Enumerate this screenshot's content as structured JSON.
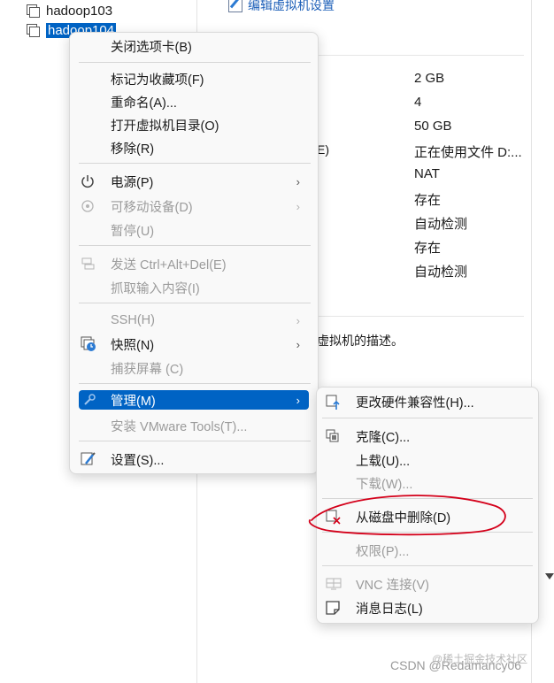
{
  "tree": {
    "items": [
      {
        "label": "hadoop103",
        "selected": false
      },
      {
        "label": "hadoop104",
        "selected": true
      }
    ]
  },
  "details": {
    "edit_link": "编辑虚拟机设置",
    "label_fragment": "E)",
    "values": [
      "2 GB",
      "4",
      "50 GB",
      "正在使用文件 D:...",
      "NAT",
      "存在",
      "自动检测",
      "存在",
      "自动检测"
    ],
    "description_fragment": "虚拟机的描述。"
  },
  "context_menu": {
    "items": [
      {
        "label": "关闭选项卡(B)",
        "enabled": true
      },
      {
        "label": "标记为收藏项(F)",
        "enabled": true
      },
      {
        "label": "重命名(A)...",
        "enabled": true
      },
      {
        "label": "打开虚拟机目录(O)",
        "enabled": true
      },
      {
        "label": "移除(R)",
        "enabled": true
      },
      {
        "label": "电源(P)",
        "enabled": true,
        "icon": "power-icon",
        "submenu": true
      },
      {
        "label": "可移动设备(D)",
        "enabled": false,
        "icon": "removable-device-icon",
        "submenu": true
      },
      {
        "label": "暂停(U)",
        "enabled": false
      },
      {
        "label": "发送 Ctrl+Alt+Del(E)",
        "enabled": false,
        "icon": "keyboard-icon"
      },
      {
        "label": "抓取输入内容(I)",
        "enabled": false
      },
      {
        "label": "SSH(H)",
        "enabled": false,
        "submenu": true
      },
      {
        "label": "快照(N)",
        "enabled": true,
        "icon": "snapshot-icon",
        "submenu": true
      },
      {
        "label": "捕获屏幕 (C)",
        "enabled": false
      },
      {
        "label": "管理(M)",
        "enabled": true,
        "icon": "wrench-icon",
        "submenu": true,
        "highlighted": true
      },
      {
        "label": "安装 VMware Tools(T)...",
        "enabled": false
      },
      {
        "label": "设置(S)...",
        "enabled": true,
        "icon": "settings-icon"
      }
    ]
  },
  "manage_submenu": {
    "items": [
      {
        "label": "更改硬件兼容性(H)...",
        "enabled": true,
        "icon": "upgrade-icon"
      },
      {
        "label": "克隆(C)...",
        "enabled": true,
        "icon": "clone-icon"
      },
      {
        "label": "上载(U)...",
        "enabled": true
      },
      {
        "label": "下载(W)...",
        "enabled": false
      },
      {
        "label": "从磁盘中删除(D)",
        "enabled": true,
        "icon": "delete-from-disk-icon",
        "annotated": true
      },
      {
        "label": "权限(P)...",
        "enabled": false
      },
      {
        "label": "VNC 连接(V)",
        "enabled": false,
        "icon": "vnc-icon"
      },
      {
        "label": "消息日志(L)",
        "enabled": true,
        "icon": "message-log-icon"
      }
    ]
  },
  "watermark": "CSDN @Redamancy06",
  "watermark2": "@稀土掘金技术社区",
  "colors": {
    "accent": "#0063c4",
    "annotation": "#d4001a",
    "disabled": "#9b9b9b"
  }
}
